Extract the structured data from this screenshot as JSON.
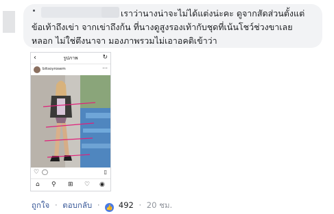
{
  "comment": {
    "text_line1": "เราว่านางน่าจะไม่ได้แต่งน่ะคะ ดูจากสัดส่วนตั้งแต่",
    "text_line2": "ข้อเท้าถึงเข่า จากเข่าถึงก้น ที่นางดูสูงรองเท้ากับชุดที่เน้นโชว์ช่วงขาเลย",
    "text_line3": "หลอก ไม่ใช่ตึงนาจา มองภาพรวมไม่เอาอคติเข้าว่า"
  },
  "instagram_post": {
    "header_title": "รูปภาพ",
    "username": "bitsoyrosem",
    "back_icon": "chevron-left-icon",
    "refresh_icon": "refresh-icon",
    "more_icon": "more-dots-icon",
    "tab_icons": [
      "home-icon",
      "search-icon",
      "add-post-icon",
      "activity-heart-icon",
      "profile-icon"
    ],
    "annotation_color": "#e0207a"
  },
  "footer": {
    "like_label": "ถูกใจ",
    "reply_label": "ตอบกลับ",
    "reaction_count": "492",
    "time": "20 ชม.",
    "separator": "·",
    "reaction_icon": "thumbs-up-icon",
    "like_color": "#4a7be4"
  }
}
